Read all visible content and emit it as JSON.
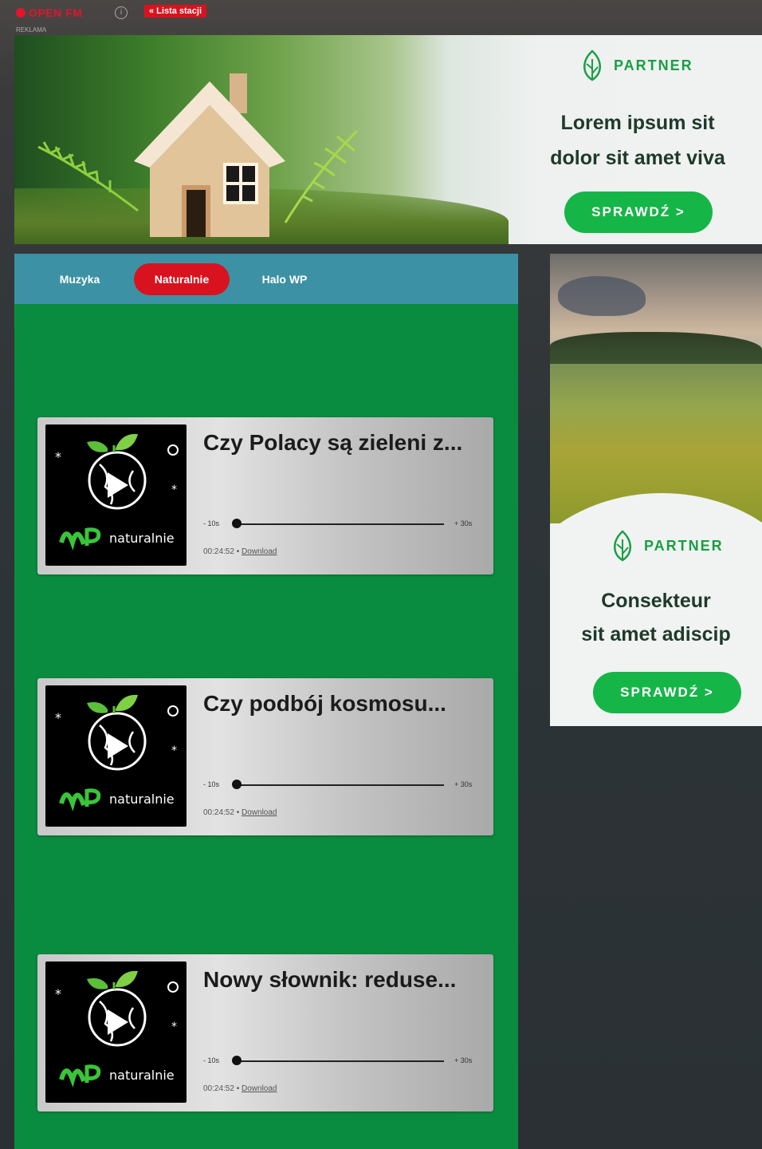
{
  "header": {
    "logo_text": "OPEN FM",
    "info_icon": "i",
    "station_list_button": "« Lista stacji",
    "ad_label": "REKLAMA"
  },
  "top_ad": {
    "partner_label": "PARTNER",
    "headline_line1": "Lorem ipsum sit",
    "headline_line2": "dolor sit amet viva",
    "cta": "SPRAWDŹ >"
  },
  "tabs": [
    {
      "label": "Muzyka",
      "active": false
    },
    {
      "label": "Naturalnie",
      "active": true
    },
    {
      "label": "Halo WP",
      "active": false
    }
  ],
  "episodes": [
    {
      "title": "Czy Polacy są zieleni z...",
      "skip_back": "- 10s",
      "skip_forward": "+ 30s",
      "duration": "00:24:52",
      "download": "Download",
      "brand": "naturalnie"
    },
    {
      "title": "Czy podbój kosmosu...",
      "skip_back": "- 10s",
      "skip_forward": "+ 30s",
      "duration": "00:24:52",
      "download": "Download",
      "brand": "naturalnie"
    },
    {
      "title": "Nowy słownik: reduse...",
      "skip_back": "- 10s",
      "skip_forward": "+ 30s",
      "duration": "00:24:52",
      "download": "Download",
      "brand": "naturalnie"
    }
  ],
  "side_ad": {
    "partner_label": "PARTNER",
    "headline_line1": "Consekteur",
    "headline_line2": "sit amet adiscip",
    "cta": "SPRAWDŹ >"
  },
  "colors": {
    "brand_red": "#d9121f",
    "panel_green": "#0a8c40",
    "tabs_blue": "#3c92a4",
    "cta_green": "#16b548"
  }
}
